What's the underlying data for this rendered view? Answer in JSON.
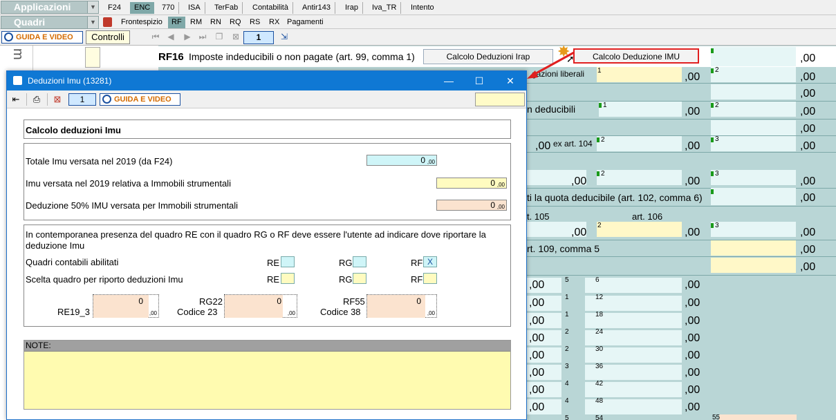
{
  "menubar": {
    "applicazioni": "Applicazioni",
    "tabs": [
      "F24",
      "ENC",
      "770",
      "ISA",
      "TerFab",
      "Contabilità",
      "Antir143",
      "Irap",
      "Iva_TR",
      "Intento"
    ],
    "active_tab": "ENC"
  },
  "subbar": {
    "quadri": "Quadri",
    "tabs": [
      "Frontespizio",
      "RF",
      "RM",
      "RN",
      "RQ",
      "RS",
      "RX",
      "Pagamenti"
    ],
    "active_tab": "RF"
  },
  "toolbar": {
    "guida": "GUIDA E VIDEO",
    "controlli": "Controlli",
    "page": "1"
  },
  "form": {
    "section_letter": "m",
    "rf16_code": "RF16",
    "rf16_label": "Imposte indeducibili o non pagate (art. 99, comma 1)",
    "btn_irap": "Calcolo Deduzioni Irap",
    "btn_imu": "Calcolo Deduzione IMU",
    "erogazioni": "gazioni liberali",
    "deducibili": "n deducibili",
    "ex_art_104": "ex art. 104",
    "quota_deducibile": "ti la quota deducibile (art. 102, comma 6)",
    "art_105": "t. 105",
    "art_106": "art. 106",
    "art_109": "rt. 109, comma 5",
    "zero": ",00",
    "zero_big": "0",
    "cols": {
      "c1": "1",
      "c2": "2",
      "c3": "3",
      "c5": "5",
      "c6": "6",
      "c11": "1",
      "c12": "12",
      "c17": "1",
      "c18": "18",
      "c23": "2",
      "c24": "24",
      "c29": "2",
      "c30": "30",
      "c35": "3",
      "c36": "36",
      "c41": "4",
      "c42": "42",
      "c47": "4",
      "c48": "48",
      "c53": "5",
      "c54": "54",
      "c55": "55"
    }
  },
  "dialog": {
    "title": "Deduzioni Imu (13281)",
    "page": "1",
    "guida": "GUIDA E VIDEO",
    "header": "Calcolo deduzioni Imu",
    "totale_label": "Totale Imu versata nel 2019 (da F24)",
    "totale_value": "0",
    "strumentali_label": "Imu versata nel 2019 relativa a Immobili strumentali",
    "strumentali_value": "0",
    "deduzione_label": "Deduzione 50% IMU versata per Immobili strumentali",
    "deduzione_value": "0",
    "dec": ",00",
    "info_text": "In contemporanea presenza del quadro RE con il quadro RG o RF deve essere l'utente ad indicare dove riportare la deduzione Imu",
    "abilitati_label": "Quadri contabili abilitati",
    "scelta_label": "Scelta quadro per riporto deduzioni Imu",
    "re": "RE",
    "rg": "RG",
    "rf": "RF",
    "rf_checked": "X",
    "re19_label": "RE19_3",
    "re19_value": "0",
    "rg22_label": "RG22",
    "rg22_sub": "Codice 23",
    "rg22_value": "0",
    "rf55_label": "RF55",
    "rf55_sub": "Codice 38",
    "rf55_value": "0",
    "note_label": "NOTE:"
  },
  "colors": {
    "title_blue": "#0f78d4",
    "teal_bg": "#b9d6d6",
    "field_cyan": "#cff5f8",
    "field_yellow": "#fffbc0",
    "field_peach": "#fbe3cf",
    "guida_orange": "#d46b00",
    "highlight_red": "#e02020"
  }
}
